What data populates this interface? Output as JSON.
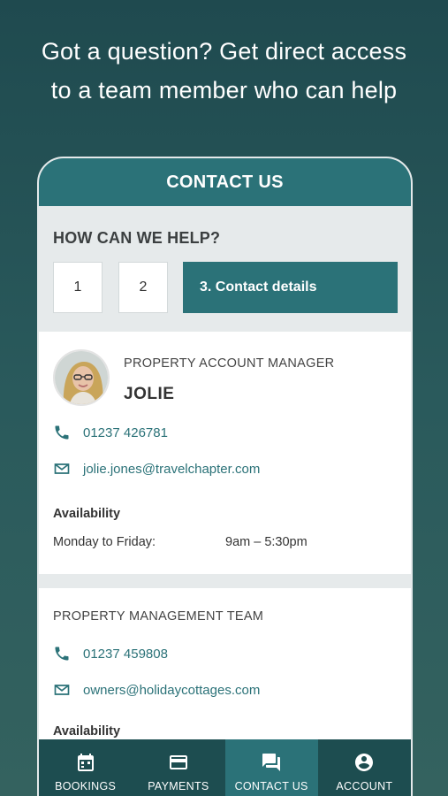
{
  "headline": {
    "line1": "Got a question? Get direct access",
    "line2": "to a team member who can help"
  },
  "header": {
    "title": "CONTACT US"
  },
  "help": {
    "title": "HOW CAN WE HELP?",
    "steps": [
      {
        "label": "1"
      },
      {
        "label": "2"
      },
      {
        "label": "3. Contact details",
        "active": true
      }
    ]
  },
  "manager": {
    "role": "PROPERTY ACCOUNT MANAGER",
    "name": "JOLIE",
    "phone": "01237 426781",
    "email": "jolie.jones@travelchapter.com",
    "availability_title": "Availability",
    "availability_days": "Monday to Friday:",
    "availability_hours": "9am – 5:30pm"
  },
  "team": {
    "title": "PROPERTY MANAGEMENT TEAM",
    "phone": "01237 459808",
    "email": "owners@holidaycottages.com",
    "availability_title": "Availability"
  },
  "nav": {
    "items": [
      {
        "label": "BOOKINGS",
        "icon": "calendar-icon"
      },
      {
        "label": "PAYMENTS",
        "icon": "card-icon"
      },
      {
        "label": "CONTACT US",
        "icon": "chat-icon",
        "active": true
      },
      {
        "label": "ACCOUNT",
        "icon": "account-icon"
      }
    ]
  },
  "colors": {
    "accent": "#2b7278",
    "nav_bg": "#1d4d50",
    "background": "#1f4a4f"
  }
}
